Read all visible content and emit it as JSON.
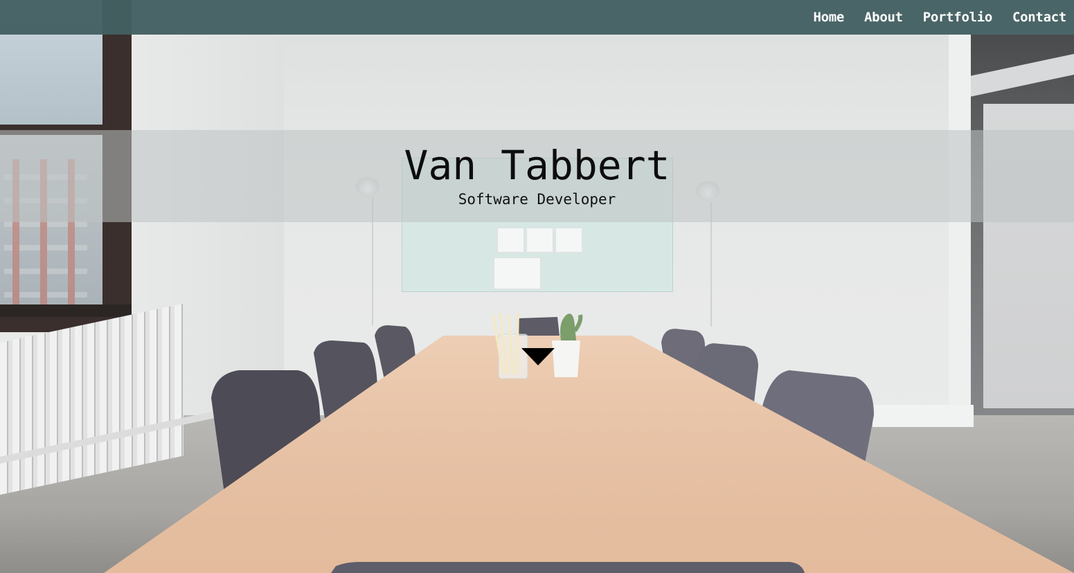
{
  "navbar": {
    "links": [
      {
        "label": "Home"
      },
      {
        "label": "About"
      },
      {
        "label": "Portfolio"
      },
      {
        "label": "Contact"
      }
    ],
    "background_color": "#466163",
    "text_color": "#ffffff"
  },
  "hero": {
    "name": "Van Tabbert",
    "title": "Software Developer",
    "scroll_icon": "triangle-down-icon"
  },
  "background": {
    "description_icon": "conference-room-photo"
  }
}
